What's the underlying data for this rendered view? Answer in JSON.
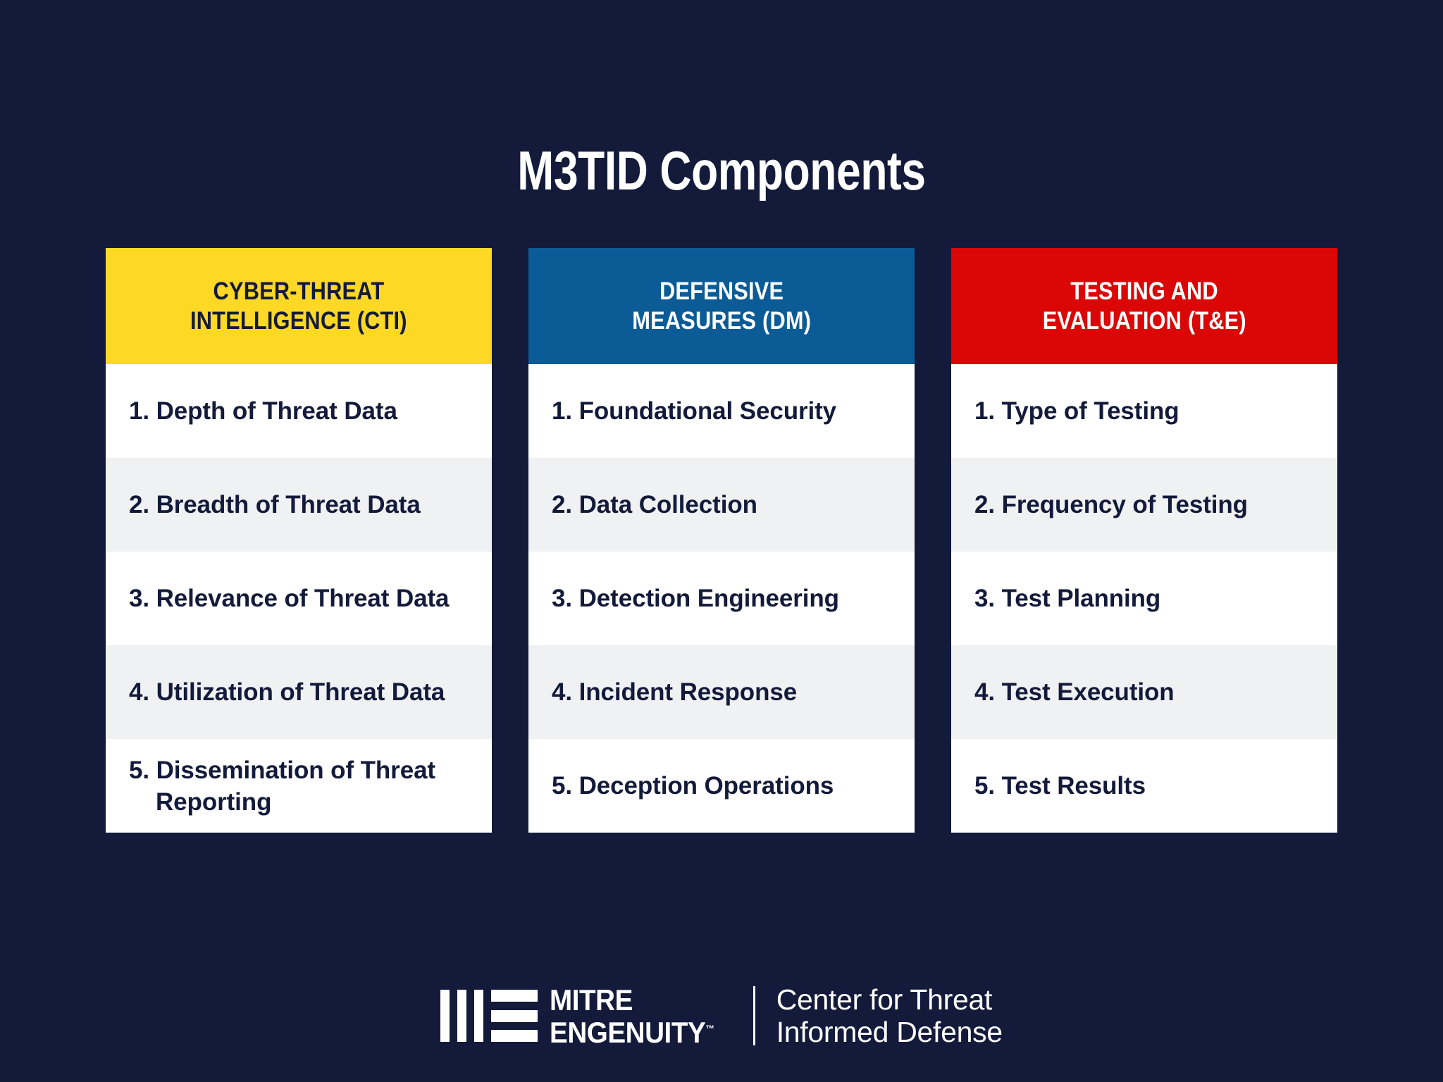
{
  "theme": {
    "background": "#131A3A",
    "title_color": "#FFFFFF",
    "row_text_color": "#131A3A",
    "row_bg": "#FFFFFF",
    "row_bg_alt": "#EFF1F3"
  },
  "title": "M3TID Components",
  "columns": [
    {
      "header_line1": "CYBER-THREAT",
      "header_line2": "INTELLIGENCE (CTI)",
      "header_bg": "#FDD825",
      "header_text_color": "#131A3A",
      "items": [
        "1. Depth of Threat Data",
        "2. Breadth of Threat Data",
        "3. Relevance of Threat Data",
        "4. Utilization of Threat Data",
        "5. Dissemination of Threat Reporting"
      ]
    },
    {
      "header_line1": "DEFENSIVE",
      "header_line2": "MEASURES (DM)",
      "header_bg": "#0A5B96",
      "header_text_color": "#FFFFFF",
      "items": [
        "1. Foundational Security",
        "2. Data Collection",
        "3. Detection Engineering",
        "4. Incident Response",
        "5. Deception Operations"
      ]
    },
    {
      "header_line1": "TESTING AND",
      "header_line2": "EVALUATION (T&E)",
      "header_bg": "#DB0707",
      "header_text_color": "#FFFFFF",
      "items": [
        "1. Type of Testing",
        "2. Frequency of Testing",
        "3. Test Planning",
        "4. Test Execution",
        "5. Test Results"
      ]
    }
  ],
  "footer": {
    "logo_mark": "mitre-engenuity-bars-icon",
    "brand_line1": "MITRE",
    "brand_line2": "ENGENUITY",
    "brand_tm": "™",
    "tagline_line1": "Center for Threat",
    "tagline_line2": "Informed Defense"
  }
}
